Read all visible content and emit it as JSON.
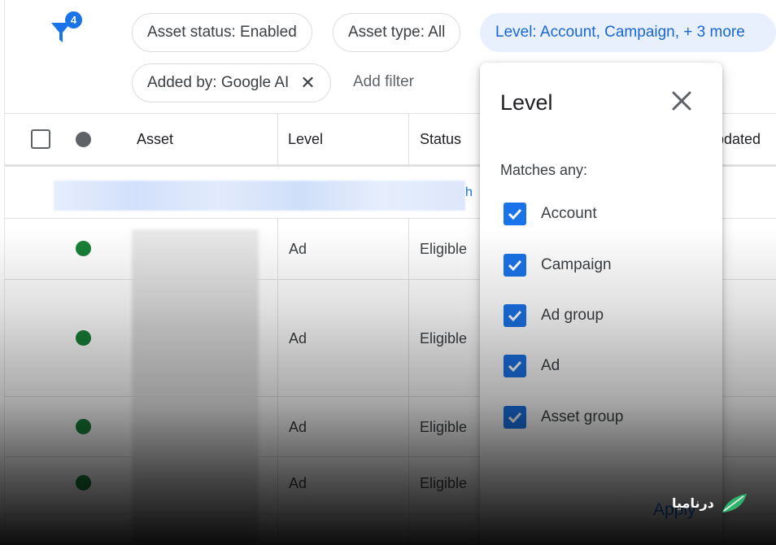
{
  "filter": {
    "badge_count": "4"
  },
  "chips": {
    "asset_status": "Asset status: Enabled",
    "asset_type": "Asset type: All",
    "level": "Level: Account, Campaign, + 3 more",
    "added_by": "Added by: Google AI"
  },
  "add_filter_label": "Add filter",
  "table": {
    "headers": {
      "asset": "Asset",
      "level": "Level",
      "status": "Status",
      "updated": "pdated"
    },
    "link_tail": "h",
    "rows": [
      {
        "level": "Ad",
        "status": "Eligible"
      },
      {
        "level": "Ad",
        "status": "Eligible"
      },
      {
        "level": "Ad",
        "status": "Eligible"
      },
      {
        "level": "Ad",
        "status": "Eligible"
      }
    ]
  },
  "popup": {
    "title": "Level",
    "matches_label": "Matches any:",
    "options": [
      {
        "label": "Account",
        "checked": true
      },
      {
        "label": "Campaign",
        "checked": true
      },
      {
        "label": "Ad group",
        "checked": true
      },
      {
        "label": "Ad",
        "checked": true
      },
      {
        "label": "Asset group",
        "checked": true
      }
    ],
    "apply_label": "Apply"
  },
  "watermark": {
    "text": "درنامیا"
  },
  "colors": {
    "accent": "#1a73e8",
    "chip_active_bg": "#e8f0fe",
    "status_green": "#188038"
  }
}
